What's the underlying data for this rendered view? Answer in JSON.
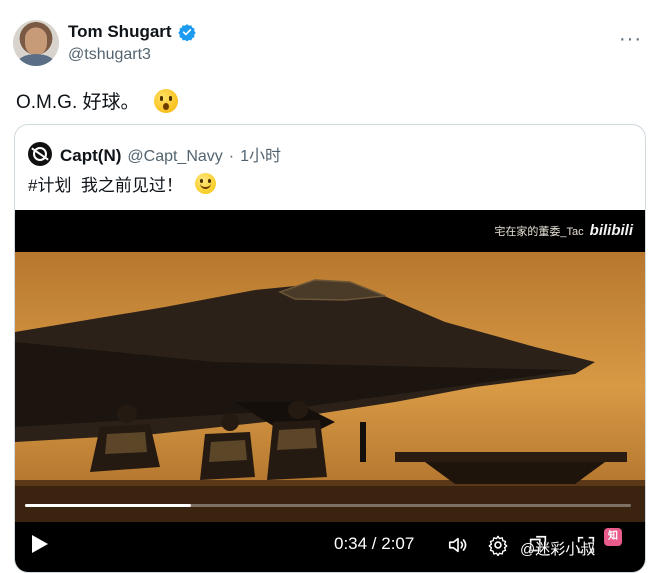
{
  "author": {
    "name": "Tom Shugart",
    "handle": "@tshugart3",
    "verified": true
  },
  "more_icon": "more-horizontal-icon",
  "tweet": {
    "text": "O.M.G. 好球。",
    "emoji": "astonished-face-emoji"
  },
  "quoted": {
    "name": "Capt(N)",
    "handle": "@Capt_Navy",
    "separator": "·",
    "time": "1小时",
    "text": "#计划  我之前见过！",
    "emoji": "slightly-smiling-face-emoji"
  },
  "video": {
    "watermark_text": "宅在家的董委_Tac",
    "watermark_logo": "bilibili",
    "progress": 0.274,
    "current_time": "0:34",
    "duration": "2:07",
    "timecode": "0:34 / 2:07"
  },
  "overlay": {
    "brand": "@迷彩小叔",
    "logo_text": "知"
  },
  "colors": {
    "text_primary": "#0f1419",
    "text_secondary": "#536471",
    "verified_blue": "#1d9bf0",
    "border": "#cfd9de",
    "scene_amber": "#d99a3b"
  }
}
